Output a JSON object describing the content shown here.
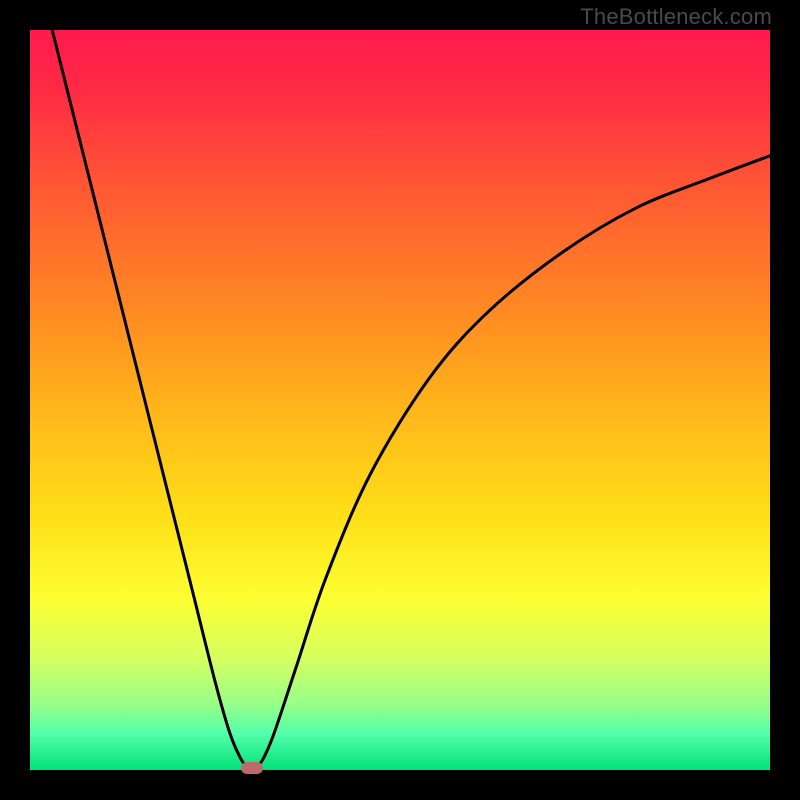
{
  "watermark": "TheBottleneck.com",
  "colors": {
    "curve": "#000000",
    "marker": "#c0696c"
  },
  "chart_data": {
    "type": "line",
    "title": "",
    "xlabel": "",
    "ylabel": "",
    "xlim": [
      0,
      100
    ],
    "ylim": [
      0,
      100
    ],
    "grid": false,
    "series": [
      {
        "name": "left-branch",
        "x": [
          3,
          6,
          10,
          14,
          18,
          22,
          25,
          27,
          28.5,
          29.5,
          30
        ],
        "y": [
          100,
          88,
          72,
          56,
          40,
          24,
          12,
          5,
          1.5,
          0.3,
          0
        ]
      },
      {
        "name": "right-branch",
        "x": [
          30,
          30.5,
          31.5,
          33,
          36,
          40,
          46,
          54,
          62,
          72,
          82,
          92,
          100
        ],
        "y": [
          0,
          0.3,
          1.5,
          5,
          14,
          26,
          40,
          53,
          62,
          70,
          76,
          80,
          83
        ]
      }
    ],
    "annotations": [
      {
        "name": "minimum-marker",
        "x": 30,
        "y": 0
      }
    ]
  }
}
